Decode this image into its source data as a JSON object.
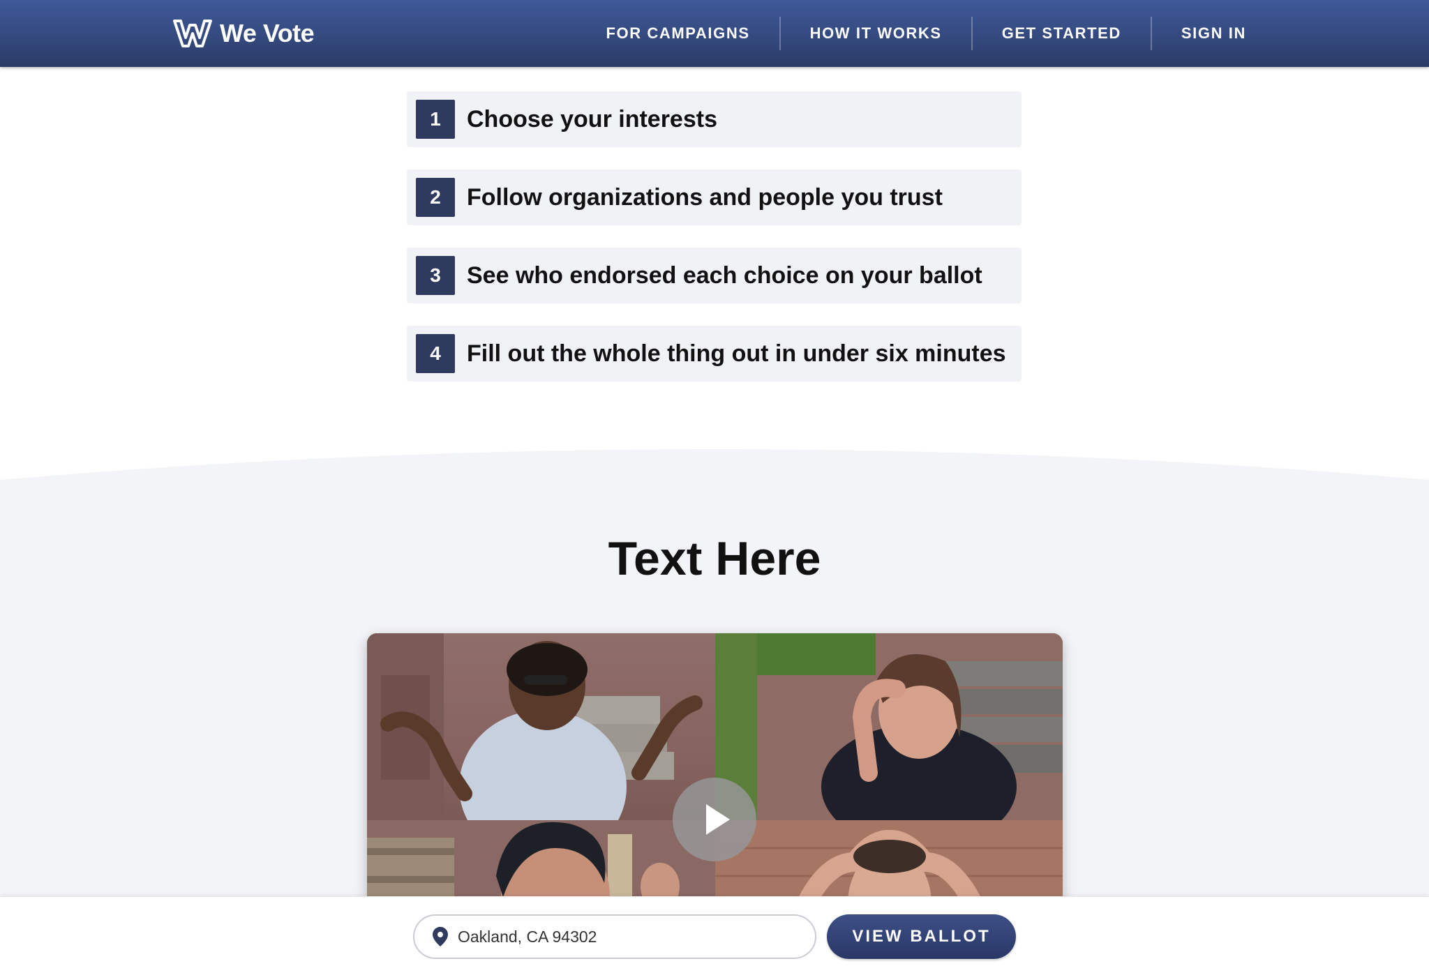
{
  "header": {
    "brand_name": "We Vote",
    "logo_icon": "we-vote-w-logo",
    "nav": [
      {
        "label": "FOR CAMPAIGNS"
      },
      {
        "label": "HOW IT WORKS"
      },
      {
        "label": "GET STARTED"
      },
      {
        "label": "SIGN IN"
      }
    ]
  },
  "steps": [
    {
      "number": "1",
      "text": "Choose your interests"
    },
    {
      "number": "2",
      "text": "Follow organizations and people you trust"
    },
    {
      "number": "3",
      "text": "See who endorsed each choice on your ballot"
    },
    {
      "number": "4",
      "text": "Fill out the whole thing out in under six minutes"
    }
  ],
  "section": {
    "title": "Text Here"
  },
  "video": {
    "play_icon": "play-icon"
  },
  "ballot_bar": {
    "address_value": "Oakland, CA 94302",
    "location_icon": "map-pin-icon",
    "button_label": "VIEW BALLOT"
  },
  "colors": {
    "header": "#34497e",
    "step_badge": "#2e3a5e",
    "step_bg": "#f1f2f5",
    "section_bg": "#f3f4f7",
    "button": "#2f3d6d"
  }
}
